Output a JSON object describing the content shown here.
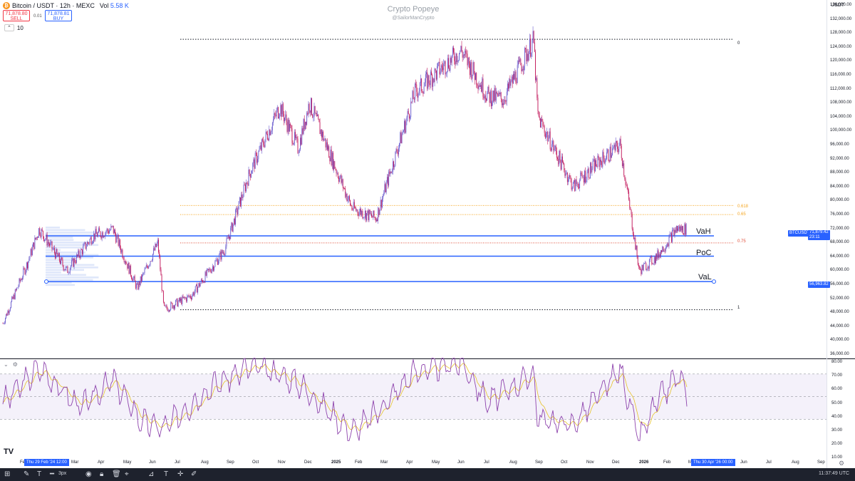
{
  "header": {
    "symbol": "Bitcoin / USDT · 12h · MEXC",
    "vol_label": "Vol",
    "vol_value": "5.58 K",
    "sell_price": "71,878.80",
    "sell_label": "SELL",
    "spread": "0.01",
    "buy_price": "71,878.81",
    "buy_label": "BUY",
    "interval_icon": "up-down-icon",
    "interval_value": "10"
  },
  "watermark": {
    "title": "Crypto Popeye",
    "handle": "@SailorManCrypto"
  },
  "price_axis": {
    "quote": "USDT",
    "labels": [
      "136,000.00",
      "132,000.00",
      "128,000.00",
      "124,000.00",
      "120,000.00",
      "116,000.00",
      "112,000.00",
      "108,000.00",
      "104,000.00",
      "100,000.00",
      "96,000.00",
      "92,000.00",
      "88,000.00",
      "84,000.00",
      "80,000.00",
      "76,000.00",
      "72,000.00",
      "68,000.00",
      "64,000.00",
      "60,000.00",
      "56,000.00",
      "52,000.00",
      "48,000.00",
      "44,000.00",
      "40,000.00",
      "36,000.00"
    ],
    "current_symbol": "BTCUSDT",
    "current_price": "71,879.42",
    "countdown": "23:11",
    "val_tag": "56,963.82",
    "current_color": "#2962ff"
  },
  "rsi_axis": {
    "labels": [
      "80.00",
      "70.00",
      "60.00",
      "50.00",
      "40.00",
      "30.00",
      "20.00",
      "10.00"
    ]
  },
  "time_axis": {
    "labels": [
      "Feb",
      "Mar",
      "Apr",
      "May",
      "Jun",
      "Jul",
      "Aug",
      "Sep",
      "Oct",
      "Nov",
      "Dec",
      "2025",
      "Feb",
      "Mar",
      "Apr",
      "May",
      "Jun",
      "Jul",
      "Aug",
      "Sep",
      "Oct",
      "Nov",
      "Dec",
      "2026",
      "Feb",
      "Mar",
      "Apr",
      "Jun",
      "Jul",
      "Aug",
      "Sep"
    ],
    "start_tag": "Thu 29 Feb '24  12:00",
    "end_tag": "Thu 30 Apr '26  00:00"
  },
  "bottom_bar": {
    "stroke_width": "3px",
    "time": "11:37:49 UTC",
    "tools": [
      "add-icon",
      "pencil-icon",
      "text-icon",
      "line-width-icon",
      "eye-icon",
      "lock-icon",
      "trash-icon",
      "cursor-icon",
      "measure-icon",
      "text-icon",
      "crosshair-icon",
      "pen-icon"
    ]
  },
  "levels": {
    "vah": "VaH",
    "poc": "PoC",
    "val": "VaL",
    "fib_0": "0",
    "fib_0618": "0.618",
    "fib_065": "0.65",
    "fib_075": "0.75",
    "fib_1": "1"
  },
  "colors": {
    "candle": "#5b4bb5",
    "level_line": "#2962ff",
    "fib_orange": "#f5a623",
    "fib_red": "#e0513d",
    "rsi_line": "#8e44ad",
    "rsi_ma": "#e6c229",
    "rsi_band": "#ede7f6"
  },
  "chart_data": {
    "type": "candlestick",
    "price_scale": {
      "min": 36000,
      "max": 136000
    },
    "price_path": {
      "x": [
        "2024-02-01",
        "2024-02-29",
        "2024-03-14",
        "2024-04-15",
        "2024-05-15",
        "2024-06-07",
        "2024-07-05",
        "2024-07-29",
        "2024-08-05",
        "2024-09-06",
        "2024-10-14",
        "2024-11-12",
        "2024-12-17",
        "2025-01-07",
        "2025-01-20",
        "2025-03-10",
        "2025-04-07",
        "2025-05-22",
        "2025-07-14",
        "2025-08-14",
        "2025-09-01",
        "2025-10-06",
        "2025-10-11",
        "2025-11-21",
        "2025-12-15",
        "2026-01-14",
        "2026-02-05",
        "2026-02-25",
        "2026-03-20",
        "2026-04-01"
      ],
      "close": [
        45000,
        62000,
        72000,
        60000,
        70000,
        72000,
        55000,
        68000,
        49000,
        53000,
        66000,
        88000,
        107000,
        95000,
        108000,
        78000,
        75000,
        111000,
        123000,
        110000,
        109000,
        126000,
        104000,
        84000,
        90000,
        96000,
        60000,
        64000,
        72000,
        71879
      ]
    },
    "horizontal_levels": [
      {
        "name": "VaH",
        "value": 70000
      },
      {
        "name": "PoC",
        "value": 64200
      },
      {
        "name": "VaL",
        "value": 56963.82
      },
      {
        "name": "0",
        "value": 126200
      },
      {
        "name": "0.618",
        "value": 78700
      },
      {
        "name": "0.65",
        "value": 76100
      },
      {
        "name": "0.75",
        "value": 68000
      },
      {
        "name": "1",
        "value": 48900
      }
    ],
    "rsi": {
      "range": [
        10,
        80
      ],
      "overbought": 70,
      "oversold": 30,
      "mid": 50,
      "x": [
        "2024-02-01",
        "2024-03-14",
        "2024-05-01",
        "2024-06-07",
        "2024-07-10",
        "2024-08-05",
        "2024-10-01",
        "2024-11-20",
        "2025-01-07",
        "2025-03-10",
        "2025-04-07",
        "2025-05-22",
        "2025-07-14",
        "2025-08-14",
        "2025-10-06",
        "2025-10-11",
        "2025-11-21",
        "2026-01-14",
        "2026-02-05",
        "2026-02-25",
        "2026-03-20",
        "2026-04-01"
      ],
      "values": [
        45,
        75,
        40,
        65,
        28,
        22,
        60,
        78,
        62,
        18,
        35,
        72,
        80,
        45,
        70,
        30,
        25,
        74,
        12,
        45,
        68,
        55
      ]
    }
  }
}
